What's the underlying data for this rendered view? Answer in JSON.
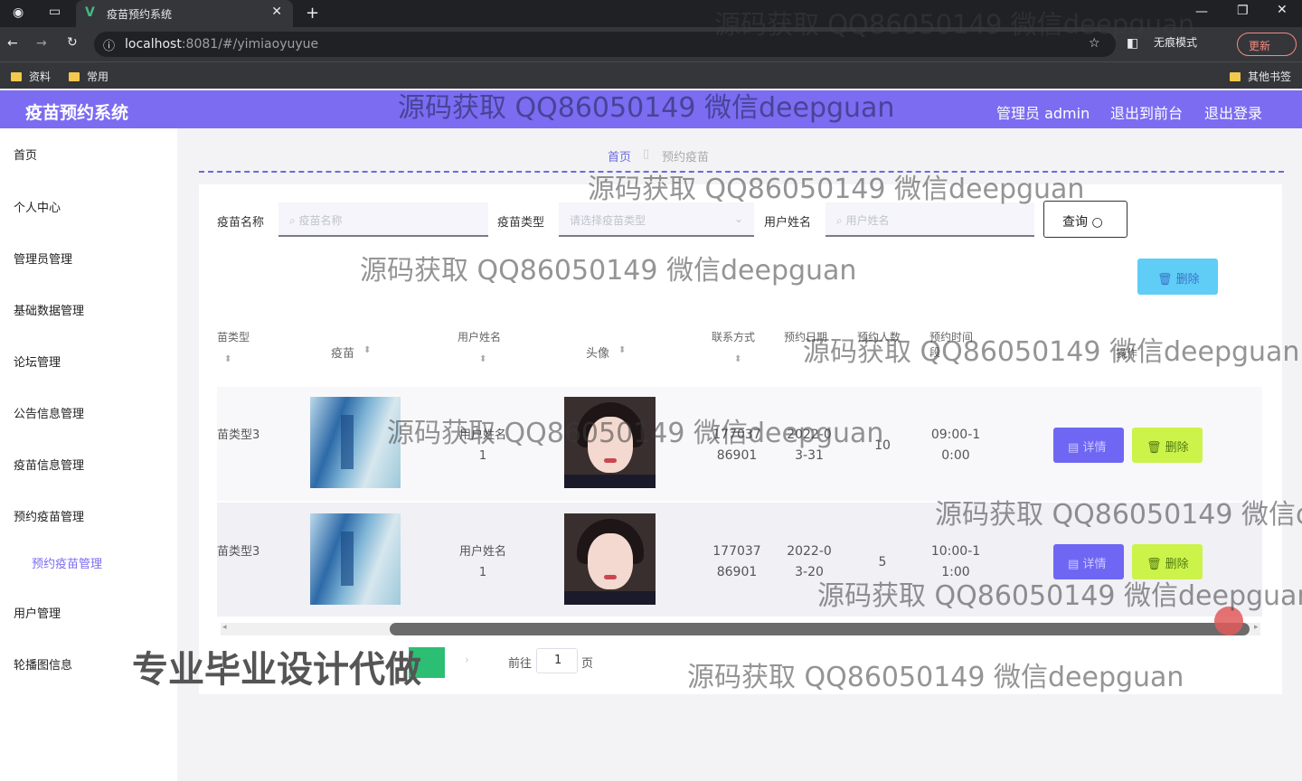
{
  "browser": {
    "tab_title": "疫苗预约系统",
    "url_host": "localhost",
    "url_rest": ":8081/#/yimiaoyuyue",
    "bookmarks": [
      "资料",
      "常用"
    ],
    "other_bookmarks": "其他书签",
    "incognito": "无痕模式",
    "update": "更新"
  },
  "header": {
    "title": "疫苗预约系统",
    "links": [
      "管理员 admin",
      "退出到前台",
      "退出登录"
    ]
  },
  "sidebar": {
    "items": [
      "首页",
      "个人中心",
      "管理员管理",
      "基础数据管理",
      "论坛管理",
      "公告信息管理",
      "疫苗信息管理",
      "预约疫苗管理",
      "用户管理",
      "轮播图信息"
    ],
    "sub_item": "预约疫苗管理"
  },
  "breadcrumb": {
    "home": "首页",
    "current": "预约疫苗"
  },
  "search": {
    "name_label": "疫苗名称",
    "name_placeholder": "疫苗名称",
    "type_label": "疫苗类型",
    "type_placeholder": "请选择疫苗类型",
    "user_label": "用户姓名",
    "user_placeholder": "用户姓名",
    "query": "查询",
    "delete": "删除"
  },
  "table": {
    "headers": [
      "苗类型",
      "疫苗",
      "用户姓名",
      "头像",
      "联系方式",
      "预约日期",
      "预约人数",
      "预约时间段",
      "操作"
    ],
    "rows": [
      {
        "type": "苗类型3",
        "user": "用户姓名1",
        "phone": "17703786901",
        "date": "2022-03-31",
        "count": "10",
        "time": "09:00-10:00"
      },
      {
        "type": "苗类型3",
        "user": "用户姓名1",
        "phone": "17703786901",
        "date": "2022-03-20",
        "count": "5",
        "time": "10:00-11:00"
      }
    ],
    "detail_label": "详情",
    "delete_label": "删除"
  },
  "pagination": {
    "goto": "前往",
    "page": "1",
    "page_suffix": "页"
  },
  "overlay": {
    "watermark": "源码获取 QQ86050149 微信deepguan",
    "watermark_cut": "源码获取 QQ86050149 微信d",
    "banner": "专业毕业设计代做"
  }
}
